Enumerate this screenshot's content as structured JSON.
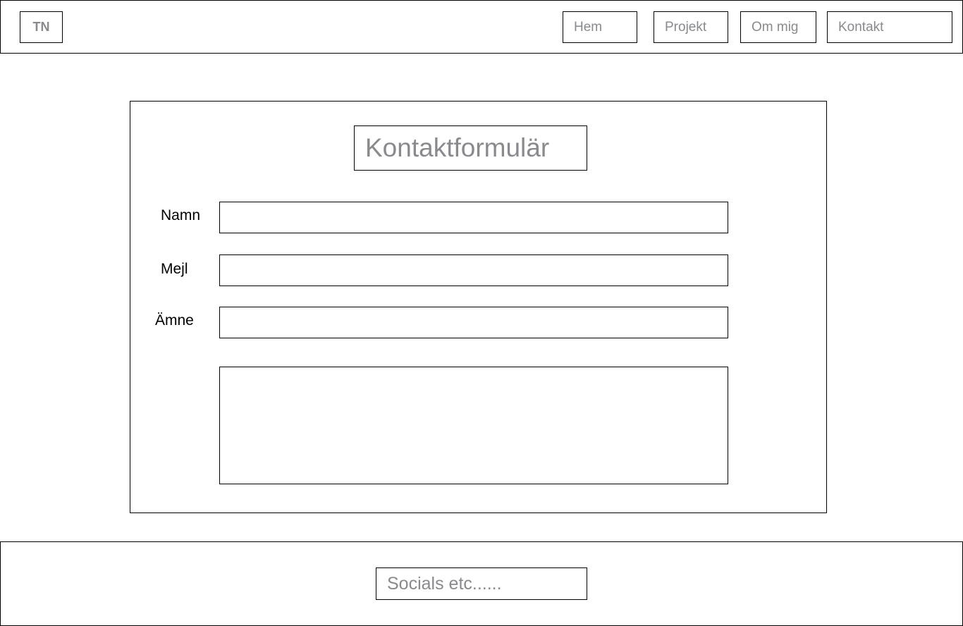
{
  "header": {
    "logo": "TN",
    "nav": {
      "hem": "Hem",
      "projekt": "Projekt",
      "om_mig": "Om mig",
      "kontakt": "Kontakt"
    }
  },
  "form": {
    "title": "Kontaktformulär",
    "labels": {
      "namn": "Namn",
      "mejl": "Mejl",
      "amne": "Ämne"
    },
    "values": {
      "namn": "",
      "mejl": "",
      "amne": "",
      "message": ""
    }
  },
  "footer": {
    "socials": "Socials etc......"
  },
  "colors": {
    "border": "#000000",
    "placeholder_text": "#888a8d",
    "background": "#ffffff"
  }
}
